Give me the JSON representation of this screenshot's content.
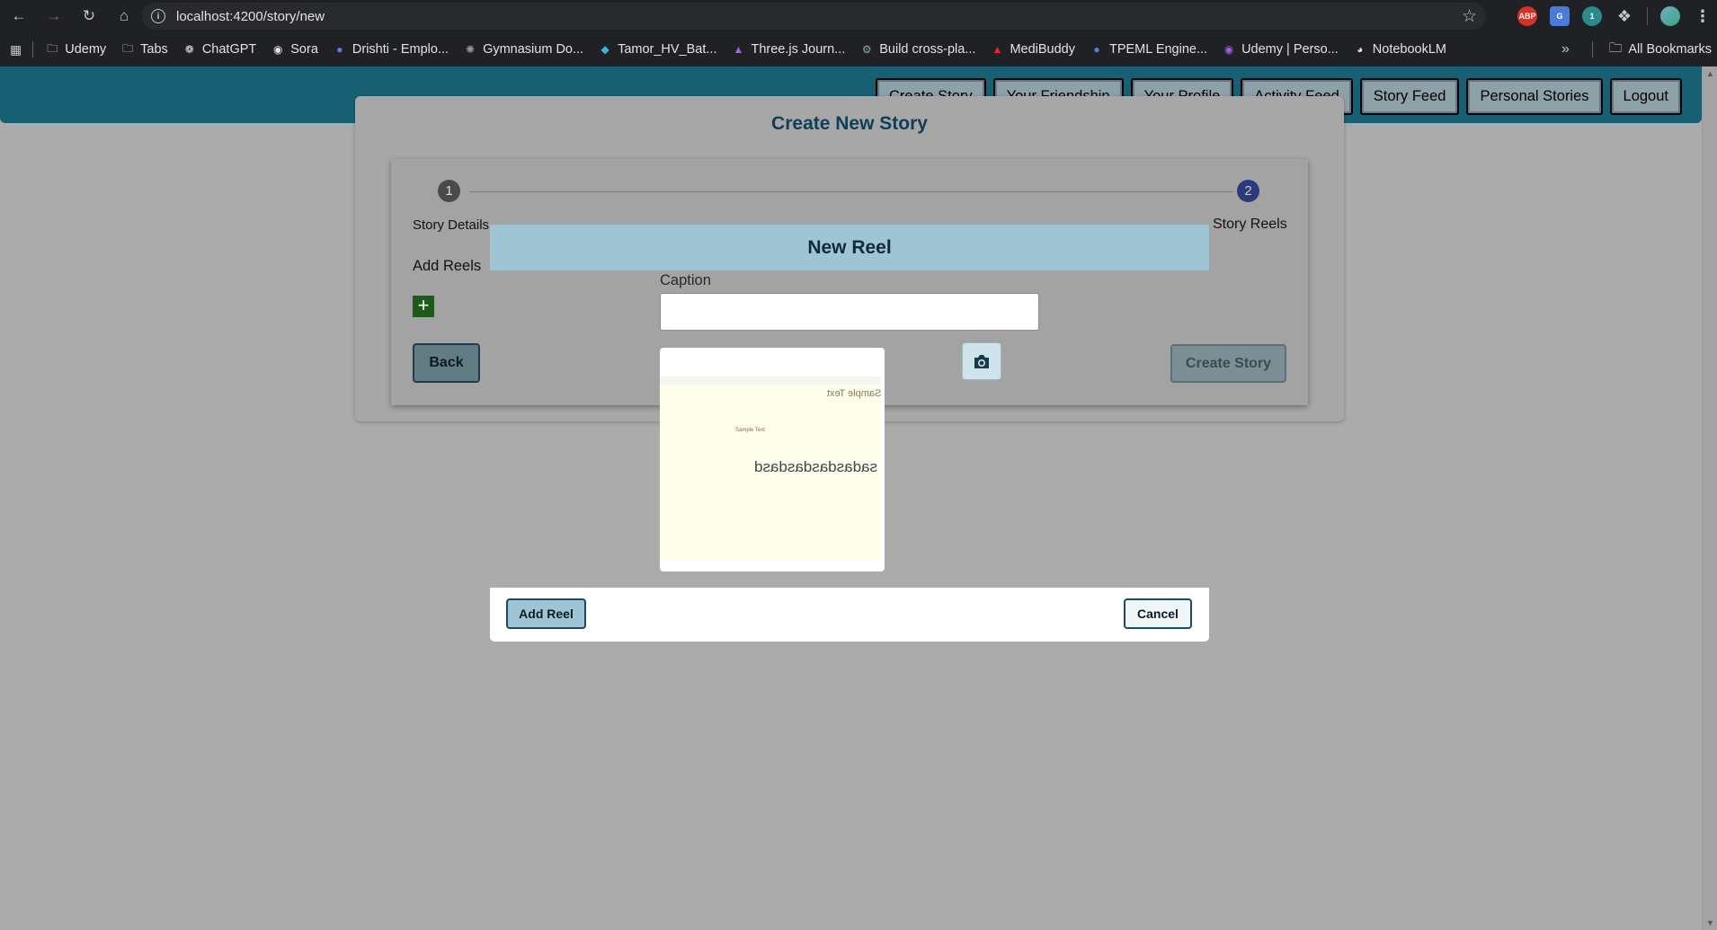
{
  "browser": {
    "url": "localhost:4200/story/new",
    "bookmarks": [
      {
        "label": "Udemy",
        "icon": "folder-icon"
      },
      {
        "label": "Tabs",
        "icon": "folder-icon"
      },
      {
        "label": "ChatGPT",
        "icon": "chatgpt-icon"
      },
      {
        "label": "Sora",
        "icon": "sora-icon"
      },
      {
        "label": "Drishti - Emplo...",
        "icon": "drishti-icon"
      },
      {
        "label": "Gymnasium Do...",
        "icon": "gymnasium-icon"
      },
      {
        "label": "Tamor_HV_Bat...",
        "icon": "tamor-icon"
      },
      {
        "label": "Three.js Journ...",
        "icon": "threejs-icon"
      },
      {
        "label": "Build cross-pla...",
        "icon": "build-icon"
      },
      {
        "label": "MediBuddy",
        "icon": "medibuddy-icon"
      },
      {
        "label": "TPEML Engine...",
        "icon": "tpeml-icon"
      },
      {
        "label": "Udemy | Perso...",
        "icon": "udemy-icon"
      },
      {
        "label": "NotebookLM",
        "icon": "notebooklm-icon"
      }
    ],
    "all_bookmarks": "All Bookmarks",
    "extension_badge": "1"
  },
  "nav": {
    "items": [
      "Create Story",
      "Your Friendship",
      "Your Profile",
      "Activity Feed",
      "Story Feed",
      "Personal Stories",
      "Logout"
    ]
  },
  "story": {
    "title": "Create New Story",
    "step1_num": "1",
    "step1_label": "Story Details",
    "step2_num": "2",
    "step2_label": "Story Reels",
    "add_reels_label": "Add Reels",
    "back_label": "Back",
    "create_label": "Create Story"
  },
  "dialog": {
    "title": "New Reel",
    "caption_label": "Caption",
    "caption_value": "",
    "preview_text_1": "Sample Text",
    "preview_text_2": "Sample Text",
    "preview_text_3": "sadasdasdasdasd",
    "add_reel_label": "Add Reel",
    "cancel_label": "Cancel"
  },
  "colors": {
    "header": "#175f73",
    "dialog_header": "#9fc4d4",
    "plus_button": "#1e5a1a",
    "step_active": "#2a3a7a"
  }
}
